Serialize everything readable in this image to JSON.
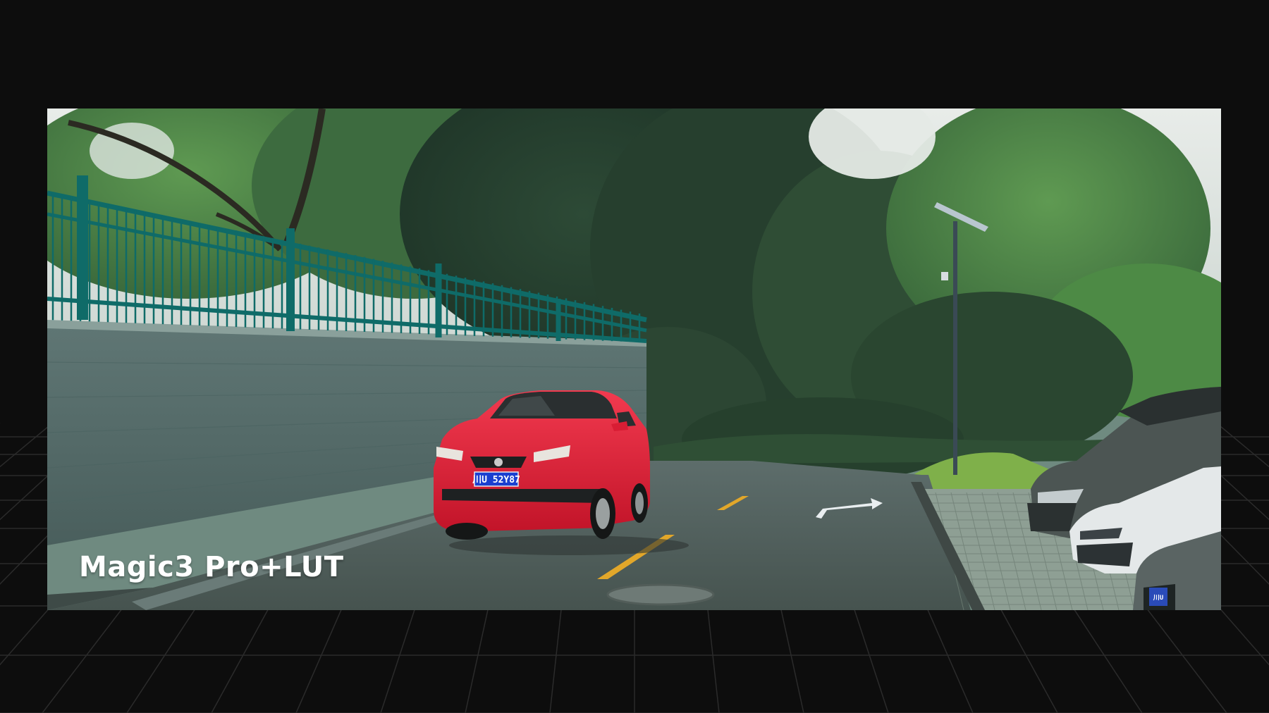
{
  "video": {
    "caption": "Magic3 Pro+LUT",
    "plates": {
      "red_car": "川U 52Y87",
      "right_car": "川U"
    }
  },
  "icons": {
    "road_arrow": "turn-right-arrow-icon"
  },
  "colors": {
    "background": "#0d0d0d",
    "grid_lines": "#2a2a2a",
    "red_car": "#e3213a",
    "fence": "#0f6b68",
    "road_marking_yellow": "#e2a72a"
  }
}
